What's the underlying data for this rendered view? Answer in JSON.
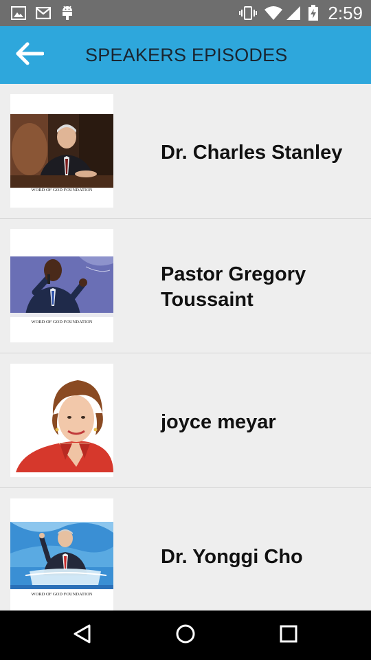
{
  "status_bar": {
    "time": "2:59",
    "left_icons": [
      "gallery-icon",
      "gmail-icon",
      "android-icon"
    ],
    "right_icons": [
      "vibrate-icon",
      "wifi-icon",
      "signal-icon",
      "battery-icon"
    ]
  },
  "app_bar": {
    "title": "SPEAKERS EPISODES",
    "back_icon": "back-arrow-icon",
    "color": "#2ea7dc"
  },
  "speakers": [
    {
      "name": "Dr. Charles Stanley",
      "caption": "WORD OF GOD FOUNDATION",
      "thumb": "charles-stanley-photo"
    },
    {
      "name": "Pastor Gregory Toussaint",
      "caption": "WORD OF GOD FOUNDATION",
      "thumb": "gregory-toussaint-photo"
    },
    {
      "name": "joyce meyar",
      "caption": "",
      "thumb": "joyce-meyer-photo"
    },
    {
      "name": "Dr. Yonggi Cho",
      "caption": "WORD OF GOD FOUNDATION",
      "thumb": "yonggi-cho-photo"
    }
  ],
  "nav_bar": {
    "icons": [
      "nav-back-icon",
      "nav-home-icon",
      "nav-recents-icon"
    ]
  }
}
